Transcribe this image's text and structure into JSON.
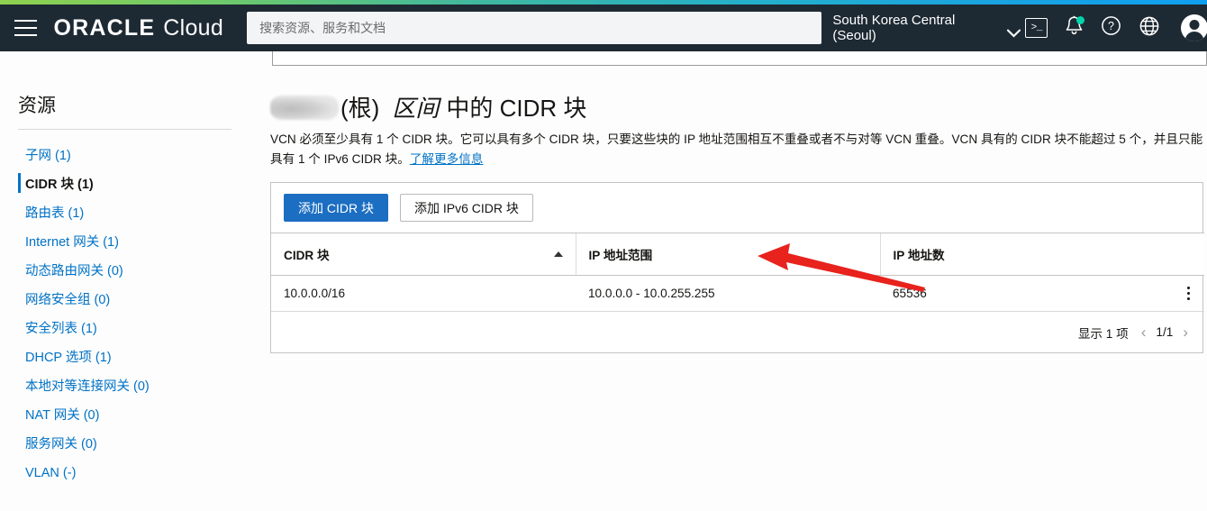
{
  "header": {
    "brand_oracle": "ORACLE",
    "brand_cloud": "Cloud",
    "search_placeholder": "搜索资源、服务和文档",
    "search_value": "",
    "region": "South Korea Central (Seoul)",
    "cloud_shell_label": ">_",
    "icons": {
      "menu": "hamburger-icon",
      "cloud_shell": "cloud-shell-icon",
      "notifications": "bell-icon",
      "help": "help-icon",
      "language": "globe-icon",
      "profile": "avatar-icon"
    },
    "notification_badge_color": "#00d3a9",
    "bar_color": "#1e2a33"
  },
  "sidebar": {
    "title": "资源",
    "items": [
      {
        "label": "子网 (1)",
        "selected": false
      },
      {
        "label": "CIDR 块 (1)",
        "selected": true
      },
      {
        "label": "路由表 (1)",
        "selected": false
      },
      {
        "label": "Internet 网关 (1)",
        "selected": false
      },
      {
        "label": "动态路由网关 (0)",
        "selected": false
      },
      {
        "label": "网络安全组 (0)",
        "selected": false
      },
      {
        "label": "安全列表 (1)",
        "selected": false
      },
      {
        "label": "DHCP 选项 (1)",
        "selected": false
      },
      {
        "label": "本地对等连接网关 (0)",
        "selected": false
      },
      {
        "label": "NAT 网关 (0)",
        "selected": false
      },
      {
        "label": "服务网关 (0)",
        "selected": false
      },
      {
        "label": "VLAN (-)",
        "selected": false
      }
    ],
    "link_color": "#0072c6"
  },
  "main": {
    "title_redacted": "",
    "title_root": "(根)",
    "title_italic": "区间",
    "title_rest": "中的 CIDR 块",
    "description": "VCN 必须至少具有 1 个 CIDR 块。它可以具有多个 CIDR 块，只要这些块的 IP 地址范围相互不重叠或者不与对等 VCN 重叠。VCN 具有的 CIDR 块不能超过 5 个，并且只能具有 1 个 IPv6 CIDR 块。",
    "learn_more": "了解更多信息",
    "buttons": {
      "add_cidr": "添加 CIDR 块",
      "add_ipv6_cidr": "添加 IPv6 CIDR 块"
    },
    "table": {
      "columns": [
        "CIDR 块",
        "IP 地址范围",
        "IP 地址数"
      ],
      "sorted_column": "CIDR 块",
      "sort_direction": "asc",
      "rows": [
        {
          "cidr": "10.0.0.0/16",
          "range": "10.0.0.0 - 10.0.255.255",
          "count": "65536"
        }
      ]
    },
    "footer": {
      "showing": "显示 1 项",
      "page": "1/1",
      "prev": "‹",
      "next": "›"
    },
    "accent_color": "#1b6ec2",
    "annotation_color": "#e8221c"
  }
}
